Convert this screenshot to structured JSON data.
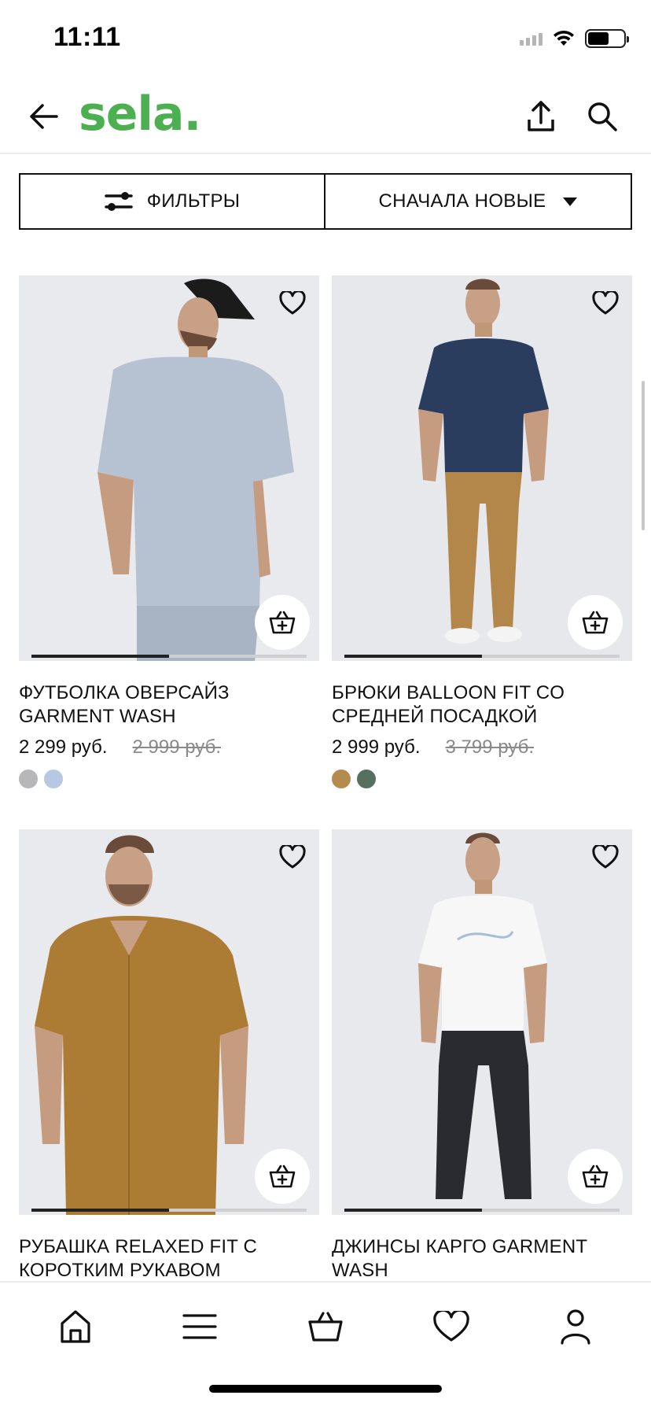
{
  "status_bar": {
    "time": "11:11"
  },
  "header": {
    "logo_text": "sela.",
    "brand_color": "#4caf50",
    "icons": [
      "arrow-left-icon",
      "share-icon",
      "search-icon"
    ]
  },
  "filters": {
    "filter_label": "ФИЛЬТРЫ",
    "sort_label": "СНАЧАЛА НОВЫЕ"
  },
  "products": [
    {
      "name": "ФУТБОЛКА ОВЕРСАЙЗ GARMENT WASH",
      "price": "2 299 руб.",
      "old_price": "2 999 руб.",
      "swatches": [
        "#b7b7b9",
        "#b7c8e2"
      ],
      "image_progress": 0.5
    },
    {
      "name": "БРЮКИ BALLOON FIT CO СРЕДНЕЙ ПОСАДКОЙ",
      "price": "2 999 руб.",
      "old_price": "3 799 руб.",
      "swatches": [
        "#b58a4d",
        "#56705f"
      ],
      "image_progress": 0.5
    },
    {
      "name": "РУБАШКА RELAXED FIT С КОРОТКИМ РУКАВОМ",
      "price": "",
      "old_price": "",
      "swatches": [],
      "image_progress": 0.5
    },
    {
      "name": "ДЖИНСЫ КАРГО GARMENT WASH",
      "price": "",
      "old_price": "",
      "swatches": [],
      "image_progress": 0.5
    }
  ],
  "tab_bar": {
    "tabs": [
      "home-icon",
      "menu-icon",
      "basket-icon",
      "heart-icon",
      "profile-icon"
    ]
  }
}
